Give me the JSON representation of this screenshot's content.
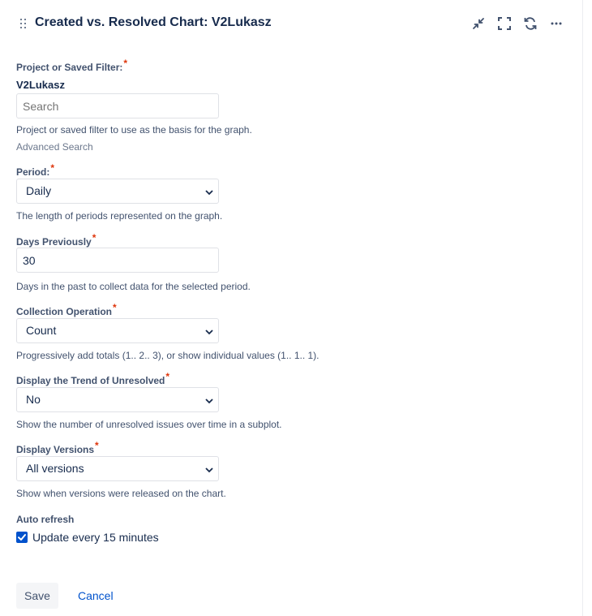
{
  "header": {
    "title": "Created vs. Resolved Chart: V2Lukasz",
    "icons": [
      "drag-handle-icon",
      "minimize-icon",
      "fullscreen-icon",
      "refresh-icon",
      "more-icon"
    ]
  },
  "form": {
    "project": {
      "label": "Project or Saved Filter:",
      "required_marker": "*",
      "selected_name": "V2Lukasz",
      "search_placeholder": "Search",
      "help": "Project or saved filter to use as the basis for the graph.",
      "advanced_link": "Advanced Search"
    },
    "period": {
      "label": "Period:",
      "required_marker": "*",
      "value": "Daily",
      "help": "The length of periods represented on the graph."
    },
    "days_previously": {
      "label": "Days Previously",
      "required_marker": "*",
      "value": "30",
      "help": "Days in the past to collect data for the selected period."
    },
    "collection_operation": {
      "label": "Collection Operation",
      "required_marker": "*",
      "value": "Count",
      "help": "Progressively add totals (1.. 2.. 3), or show individual values (1.. 1.. 1)."
    },
    "trend_unresolved": {
      "label": "Display the Trend of Unresolved",
      "required_marker": "*",
      "value": "No",
      "help": "Show the number of unresolved issues over time in a subplot."
    },
    "versions": {
      "label": "Display Versions",
      "required_marker": "*",
      "value": "All versions",
      "help": "Show when versions were released on the chart."
    },
    "auto_refresh": {
      "label": "Auto refresh",
      "checkbox_label": "Update every 15 minutes",
      "checked": true
    }
  },
  "actions": {
    "save_label": "Save",
    "cancel_label": "Cancel"
  },
  "colors": {
    "accent": "#0052cc",
    "required": "#de350b",
    "text": "#172b4d",
    "subtle_text": "#42526e",
    "border": "#dfe1e6"
  }
}
